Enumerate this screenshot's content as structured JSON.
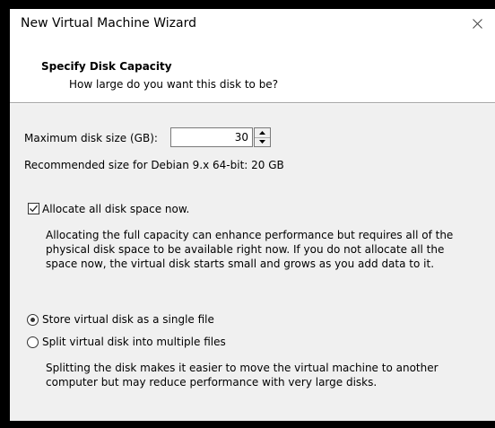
{
  "window": {
    "title": "New Virtual Machine Wizard"
  },
  "header": {
    "title": "Specify Disk Capacity",
    "subtitle": "How large do you want this disk to be?"
  },
  "disk": {
    "size_label": "Maximum disk size (GB):",
    "size_value": "30",
    "recommended": "Recommended size for Debian 9.x 64-bit: 20 GB"
  },
  "allocate": {
    "label": "Allocate all disk space now.",
    "checked": true,
    "desc_lines": [
      "Allocating the full capacity can enhance performance but requires all of the",
      "physical disk space to be available right now. If you do not allocate all the",
      "space now, the virtual disk starts small and grows as you add data to it."
    ]
  },
  "storage": {
    "single_label": "Store virtual disk as a single file",
    "multi_label": "Split virtual disk into multiple files",
    "selected": "single",
    "desc_lines": [
      "Splitting the disk makes it easier to move the virtual machine to another",
      "computer but may reduce performance with very large disks."
    ]
  },
  "icons": {
    "close": "close-icon",
    "spin_up": "arrow-up-icon",
    "spin_down": "arrow-down-icon",
    "check": "checkmark-icon"
  }
}
